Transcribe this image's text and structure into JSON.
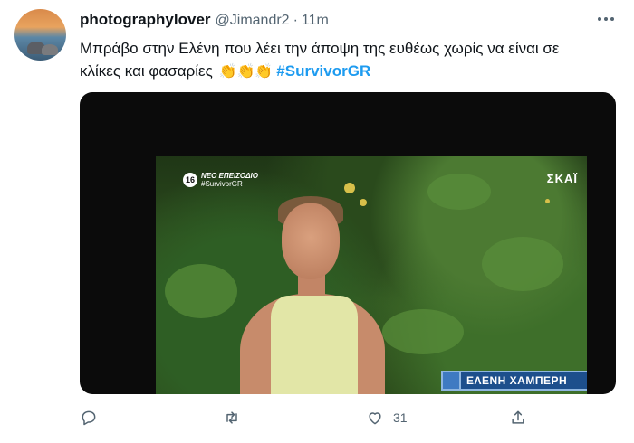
{
  "tweet": {
    "display_name": "photographylover",
    "handle": "@Jimandr2",
    "separator": "·",
    "time": "11m",
    "text_line1": "Μπράβο στην Ελένη που λέει την άποψη της ευθέως χωρίς να είναι σε",
    "text_line2": "κλίκες και φασαρίες",
    "clap_emoji": "👏👏👏",
    "hashtag": "#SurvivorGR",
    "media": {
      "logo_number": "16",
      "logo_line1": "ΝΕΟ ΕΠΕΙΣΟΔΙΟ",
      "logo_line2": "#SurvivorGR",
      "channel": "ΣΚΑΪ",
      "lower_third_name": "ΕΛΕΝΗ ΧΑΜΠΕΡΗ"
    },
    "actions": {
      "reply_icon": "reply-icon",
      "retweet_icon": "retweet-icon",
      "like_icon": "like-icon",
      "like_count": "31",
      "share_icon": "share-icon"
    },
    "colors": {
      "hashtag": "#1d9bf0",
      "secondary_text": "#536471",
      "primary_text": "#0f1419"
    }
  }
}
